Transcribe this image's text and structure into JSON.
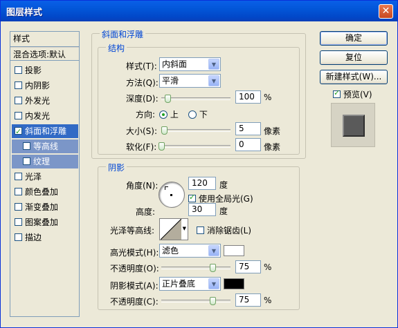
{
  "window": {
    "title": "图层样式",
    "close_glyph": "✕"
  },
  "stylelist": {
    "header": "样式",
    "blend": "混合选项:默认",
    "items": [
      {
        "label": "投影",
        "checked": false
      },
      {
        "label": "内阴影",
        "checked": false
      },
      {
        "label": "外发光",
        "checked": false
      },
      {
        "label": "内发光",
        "checked": false
      },
      {
        "label": "斜面和浮雕",
        "checked": true
      },
      {
        "label": "等高线",
        "checked": false
      },
      {
        "label": "纹理",
        "checked": false
      },
      {
        "label": "光泽",
        "checked": false
      },
      {
        "label": "颜色叠加",
        "checked": false
      },
      {
        "label": "渐变叠加",
        "checked": false
      },
      {
        "label": "图案叠加",
        "checked": false
      },
      {
        "label": "描边",
        "checked": false
      }
    ]
  },
  "bevel": {
    "group_title": "斜面和浮雕",
    "structure_title": "结构",
    "style_label": "样式(T):",
    "style_value": "内斜面",
    "method_label": "方法(Q):",
    "method_value": "平滑",
    "depth_label": "深度(D):",
    "depth_value": "100",
    "depth_unit": "%",
    "direction_label": "方向:",
    "dir_up": "上",
    "dir_down": "下",
    "size_label": "大小(S):",
    "size_value": "5",
    "size_unit": "像素",
    "soften_label": "软化(F):",
    "soften_value": "0",
    "soften_unit": "像素"
  },
  "shading": {
    "group_title": "阴影",
    "angle_label": "角度(N):",
    "angle_value": "120",
    "angle_unit": "度",
    "global_light_label": "使用全局光(G)",
    "altitude_label": "高度:",
    "altitude_value": "30",
    "altitude_unit": "度",
    "gloss_label": "光泽等高线:",
    "antialias_label": "消除锯齿(L)",
    "highlight_mode_label": "高光模式(H):",
    "highlight_mode_value": "滤色",
    "highlight_color": "#ffffff",
    "highlight_opacity_label": "不透明度(O):",
    "highlight_opacity_value": "75",
    "shadow_mode_label": "阴影模式(A):",
    "shadow_mode_value": "正片叠底",
    "shadow_color": "#000000",
    "shadow_opacity_label": "不透明度(C):",
    "shadow_opacity_value": "75",
    "percent": "%"
  },
  "buttons": {
    "ok": "确定",
    "reset": "复位",
    "new_style": "新建样式(W)...",
    "preview": "预览(V)"
  }
}
